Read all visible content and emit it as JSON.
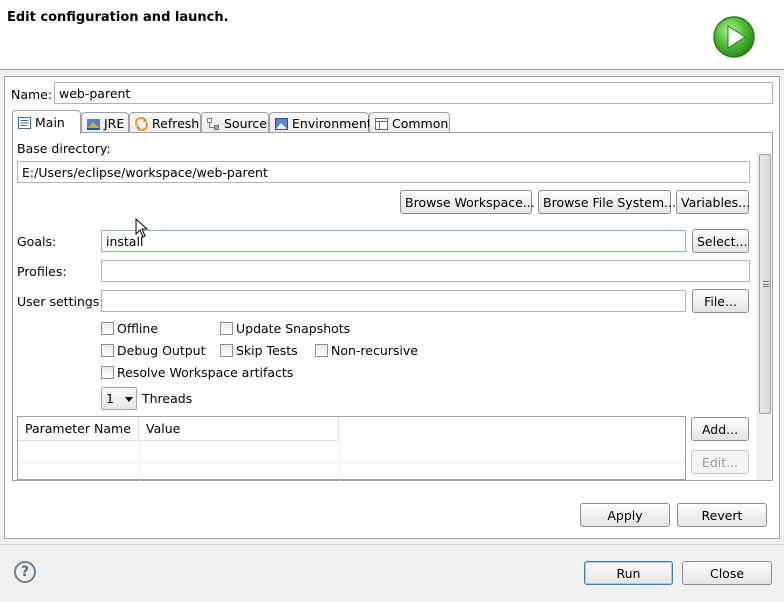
{
  "header": {
    "title": "Edit configuration and launch."
  },
  "name_field": {
    "label": "Name:",
    "value": "web-parent"
  },
  "tabs": [
    {
      "label": "Main",
      "icon": "main-tab-icon"
    },
    {
      "label": "JRE",
      "icon": "jre-icon"
    },
    {
      "label": "Refresh",
      "icon": "refresh-icon"
    },
    {
      "label": "Source",
      "icon": "source-icon"
    },
    {
      "label": "Environment",
      "icon": "environment-icon"
    },
    {
      "label": "Common",
      "icon": "common-icon"
    }
  ],
  "main": {
    "base_directory": {
      "label": "Base directory:",
      "value": "E:/Users/eclipse/workspace/web-parent",
      "browse_workspace": "Browse Workspace...",
      "browse_file_system": "Browse File System...",
      "variables": "Variables..."
    },
    "goals": {
      "label": "Goals:",
      "value": "install",
      "select_button": "Select..."
    },
    "profiles": {
      "label": "Profiles:",
      "value": ""
    },
    "user_settings": {
      "label": "User settings:",
      "value": "",
      "file_button": "File..."
    },
    "options": {
      "offline": "Offline",
      "update_snapshots": "Update Snapshots",
      "debug_output": "Debug Output",
      "skip_tests": "Skip Tests",
      "non_recursive": "Non-recursive",
      "resolve_workspace": "Resolve Workspace artifacts"
    },
    "threads": {
      "value": "1",
      "label": "Threads"
    },
    "params_table": {
      "columns": [
        "Parameter Name",
        "Value"
      ],
      "add_button": "Add...",
      "edit_button": "Edit..."
    }
  },
  "footer": {
    "apply": "Apply",
    "revert": "Revert",
    "run": "Run",
    "close": "Close",
    "help_glyph": "?"
  },
  "colors": {
    "run_icon_green": "#3fae2a",
    "focus_border": "#7eb4ea"
  }
}
